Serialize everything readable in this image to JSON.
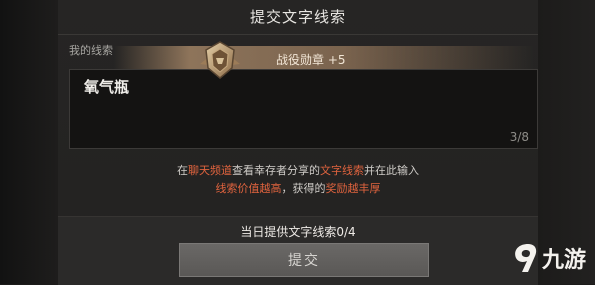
{
  "dialog": {
    "title": "提交文字线索",
    "my_clue_label": "我的线索",
    "reward_text": "战役勋章 +5",
    "clue": {
      "value": "氧气瓶",
      "counter": "3/8"
    },
    "hint": {
      "line1": [
        {
          "text": "在",
          "hl": false
        },
        {
          "text": "聊天频道",
          "hl": true
        },
        {
          "text": "查看幸存者分享的",
          "hl": false
        },
        {
          "text": "文字线索",
          "hl": true
        },
        {
          "text": "并在此输入",
          "hl": false
        }
      ],
      "line2": [
        {
          "text": "线索价值越高",
          "hl": true
        },
        {
          "text": "，获得的",
          "hl": false
        },
        {
          "text": "奖励越丰厚",
          "hl": true
        }
      ]
    },
    "daily_label": "当日提供文字线索",
    "daily_count": "0/4",
    "submit_label": "提交"
  },
  "watermark": {
    "text": "九游",
    "icon": "jiuyou-logo-icon"
  },
  "colors": {
    "highlight": "#e0633e",
    "panel": "#262524",
    "button": "#62605e"
  }
}
